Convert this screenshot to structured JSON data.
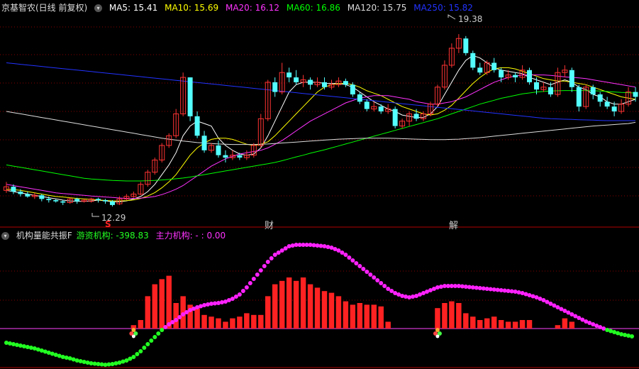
{
  "main_panel": {
    "title": "京基智农(日线 前复权)",
    "ma": [
      {
        "label": "MA5: 15.41",
        "color": "#ffffff"
      },
      {
        "label": "MA10: 15.69",
        "color": "#ffff00"
      },
      {
        "label": "MA20: 16.12",
        "color": "#ff33ff"
      },
      {
        "label": "MA60: 16.86",
        "color": "#00ff00"
      },
      {
        "label": "MA120: 15.75",
        "color": "#dddddd"
      },
      {
        "label": "MA250: 15.82",
        "color": "#2233ff"
      }
    ],
    "high_label": "19.38",
    "low_label": "12.29",
    "markers": [
      {
        "text": "S",
        "color": "#ff2222"
      },
      {
        "text": "财",
        "color": "#cccccc"
      },
      {
        "text": "解",
        "color": "#cccccc"
      }
    ],
    "menu_icon": "chevron-down-icon"
  },
  "sub_panel": {
    "title": "机构量能共振F",
    "youzi_label": "游资机构: -398.83",
    "zhuli_label": "主力机构: - : 0.00",
    "menu_icon": "chevron-down-icon"
  },
  "colors": {
    "up": "#ff3333",
    "down": "#54ffff",
    "bar": "#ff2222",
    "line_pos": "#ff22ff",
    "line_neg": "#22ff22",
    "axis": "#ff44ff"
  },
  "chart_data": {
    "type": "candlestick",
    "y_range_price": [
      11.5,
      20.2
    ],
    "candles": [
      [
        12.95,
        13.1,
        13.3,
        12.85
      ],
      [
        13.1,
        12.9,
        13.2,
        12.8
      ],
      [
        12.9,
        12.8,
        13.0,
        12.7
      ],
      [
        12.8,
        12.7,
        12.9,
        12.65
      ],
      [
        12.7,
        12.75,
        12.85,
        12.6
      ],
      [
        12.75,
        12.6,
        12.8,
        12.5
      ],
      [
        12.6,
        12.55,
        12.7,
        12.45
      ],
      [
        12.55,
        12.5,
        12.6,
        12.45
      ],
      [
        12.5,
        12.45,
        12.55,
        12.35
      ],
      [
        12.45,
        12.6,
        12.65,
        12.4
      ],
      [
        12.6,
        12.5,
        12.65,
        12.4
      ],
      [
        12.5,
        12.55,
        12.6,
        12.45
      ],
      [
        12.5,
        12.6,
        12.65,
        12.45
      ],
      [
        12.6,
        12.55,
        12.65,
        12.45
      ],
      [
        12.55,
        12.5,
        12.6,
        12.4
      ],
      [
        12.5,
        12.35,
        12.55,
        12.29
      ],
      [
        12.4,
        12.6,
        12.7,
        12.35
      ],
      [
        12.6,
        12.7,
        12.8,
        12.55
      ],
      [
        12.7,
        12.8,
        12.9,
        12.65
      ],
      [
        12.8,
        13.2,
        13.3,
        12.75
      ],
      [
        13.2,
        13.7,
        13.8,
        13.1
      ],
      [
        13.7,
        14.2,
        14.3,
        13.6
      ],
      [
        14.2,
        14.8,
        14.9,
        14.1
      ],
      [
        14.8,
        15.2,
        15.3,
        14.7
      ],
      [
        15.2,
        16.1,
        16.3,
        15.1
      ],
      [
        16.1,
        17.6,
        17.8,
        16.0
      ],
      [
        17.6,
        16.0,
        17.6,
        15.8
      ],
      [
        16.0,
        15.2,
        16.2,
        15.1
      ],
      [
        15.2,
        14.6,
        15.4,
        14.5
      ],
      [
        14.6,
        14.8,
        14.9,
        14.5
      ],
      [
        14.8,
        14.4,
        15.0,
        14.3
      ],
      [
        14.4,
        14.3,
        14.6,
        14.1
      ],
      [
        14.3,
        14.4,
        14.6,
        14.2
      ],
      [
        14.4,
        14.3,
        14.5,
        14.2
      ],
      [
        14.3,
        14.4,
        14.6,
        14.2
      ],
      [
        14.4,
        14.8,
        14.9,
        14.3
      ],
      [
        14.8,
        15.9,
        16.1,
        14.7
      ],
      [
        15.9,
        17.4,
        17.5,
        15.8
      ],
      [
        17.4,
        17.0,
        17.6,
        16.8
      ],
      [
        17.0,
        17.8,
        18.2,
        16.9
      ],
      [
        17.8,
        17.6,
        18.0,
        17.4
      ],
      [
        17.6,
        17.4,
        17.9,
        17.3
      ],
      [
        17.4,
        17.5,
        17.7,
        17.2
      ],
      [
        17.5,
        17.3,
        17.6,
        17.1
      ],
      [
        17.3,
        17.4,
        17.6,
        17.2
      ],
      [
        17.4,
        17.2,
        17.6,
        17.1
      ],
      [
        17.2,
        17.3,
        17.5,
        17.1
      ],
      [
        17.3,
        17.45,
        17.6,
        17.2
      ],
      [
        17.45,
        17.3,
        17.55,
        17.2
      ],
      [
        17.3,
        16.9,
        17.4,
        16.8
      ],
      [
        16.9,
        16.6,
        17.0,
        16.5
      ],
      [
        16.6,
        16.3,
        16.7,
        16.2
      ],
      [
        16.3,
        16.4,
        16.6,
        16.2
      ],
      [
        16.4,
        16.2,
        16.5,
        16.1
      ],
      [
        16.2,
        16.3,
        16.5,
        16.1
      ],
      [
        16.3,
        15.6,
        16.4,
        15.5
      ],
      [
        15.6,
        15.8,
        15.9,
        15.5
      ],
      [
        15.8,
        16.1,
        16.2,
        15.6
      ],
      [
        16.1,
        15.9,
        16.3,
        15.8
      ],
      [
        15.9,
        16.1,
        16.2,
        15.8
      ],
      [
        16.1,
        16.5,
        16.6,
        16.0
      ],
      [
        16.5,
        17.2,
        17.3,
        16.4
      ],
      [
        17.2,
        18.1,
        18.3,
        17.1
      ],
      [
        18.1,
        18.8,
        19.0,
        18.0
      ],
      [
        18.8,
        19.2,
        19.38,
        18.6
      ],
      [
        19.2,
        18.6,
        19.3,
        18.5
      ],
      [
        18.6,
        18.0,
        18.7,
        17.9
      ],
      [
        18.0,
        17.8,
        18.2,
        17.7
      ],
      [
        17.8,
        18.2,
        18.3,
        17.7
      ],
      [
        18.2,
        17.9,
        18.4,
        17.8
      ],
      [
        17.9,
        17.6,
        18.0,
        17.4
      ],
      [
        17.6,
        17.7,
        17.9,
        17.5
      ],
      [
        17.7,
        17.6,
        17.8,
        17.4
      ],
      [
        17.6,
        17.9,
        18.1,
        17.5
      ],
      [
        17.9,
        17.4,
        18.0,
        17.3
      ],
      [
        17.4,
        17.1,
        17.6,
        16.9
      ],
      [
        17.1,
        17.2,
        17.4,
        17.0
      ],
      [
        17.2,
        16.9,
        17.4,
        16.8
      ],
      [
        16.9,
        17.8,
        18.0,
        16.8
      ],
      [
        17.8,
        17.9,
        18.1,
        17.6
      ],
      [
        17.9,
        17.2,
        18.0,
        17.0
      ],
      [
        17.2,
        16.4,
        17.3,
        16.2
      ],
      [
        16.4,
        17.2,
        17.3,
        16.3
      ],
      [
        17.2,
        16.9,
        17.3,
        16.7
      ],
      [
        16.9,
        16.6,
        17.0,
        16.4
      ],
      [
        16.6,
        16.4,
        16.8,
        16.3
      ],
      [
        16.4,
        16.2,
        16.6,
        16.0
      ],
      [
        16.2,
        16.5,
        16.7,
        16.1
      ],
      [
        16.5,
        17.0,
        17.2,
        16.4
      ],
      [
        17.0,
        16.8,
        17.2,
        16.6
      ]
    ],
    "ma_lines": {
      "ma5": [
        12.95,
        12.9,
        12.85,
        12.8,
        12.75,
        12.7,
        12.65,
        12.6,
        12.55,
        12.52,
        12.5,
        12.5,
        12.52,
        12.55,
        12.52,
        12.48,
        12.48,
        12.52,
        12.6,
        12.7,
        12.9,
        13.2,
        13.6,
        14.0,
        14.5,
        15.2,
        15.6,
        15.8,
        15.7,
        15.6,
        15.1,
        14.8,
        14.6,
        14.45,
        14.4,
        14.45,
        14.7,
        15.2,
        15.8,
        16.4,
        17.0,
        17.3,
        17.4,
        17.4,
        17.4,
        17.35,
        17.35,
        17.35,
        17.3,
        17.2,
        17.0,
        16.8,
        16.6,
        16.45,
        16.3,
        16.2,
        16.05,
        16.0,
        15.95,
        15.95,
        16.1,
        16.4,
        16.9,
        17.4,
        17.9,
        18.3,
        18.5,
        18.4,
        18.2,
        18.0,
        17.9,
        17.85,
        17.8,
        17.75,
        17.6,
        17.5,
        17.4,
        17.3,
        17.4,
        17.5,
        17.4,
        17.2,
        17.1,
        16.9,
        16.8,
        16.6,
        16.5,
        16.5,
        16.6,
        16.7
      ],
      "ma10": [
        13.0,
        12.98,
        12.95,
        12.9,
        12.85,
        12.8,
        12.75,
        12.7,
        12.68,
        12.65,
        12.62,
        12.6,
        12.58,
        12.56,
        12.54,
        12.52,
        12.52,
        12.53,
        12.56,
        12.62,
        12.72,
        12.86,
        13.06,
        13.3,
        13.6,
        14.0,
        14.4,
        14.7,
        14.9,
        15.05,
        15.1,
        15.1,
        15.05,
        14.95,
        14.85,
        14.8,
        14.85,
        14.95,
        15.2,
        15.5,
        15.8,
        16.1,
        16.4,
        16.7,
        17.0,
        17.2,
        17.3,
        17.35,
        17.35,
        17.3,
        17.2,
        17.05,
        16.95,
        16.85,
        16.7,
        16.55,
        16.4,
        16.3,
        16.2,
        16.1,
        16.05,
        16.1,
        16.25,
        16.45,
        16.75,
        17.05,
        17.35,
        17.6,
        17.8,
        17.95,
        18.0,
        18.0,
        17.95,
        17.85,
        17.75,
        17.65,
        17.55,
        17.5,
        17.45,
        17.45,
        17.4,
        17.35,
        17.3,
        17.2,
        17.1,
        17.0,
        16.9,
        16.8,
        16.75,
        16.7
      ],
      "ma20": [
        13.2,
        13.15,
        13.1,
        13.05,
        13.0,
        12.95,
        12.9,
        12.85,
        12.82,
        12.8,
        12.77,
        12.75,
        12.72,
        12.7,
        12.68,
        12.66,
        12.64,
        12.62,
        12.62,
        12.63,
        12.66,
        12.7,
        12.78,
        12.88,
        13.0,
        13.15,
        13.35,
        13.55,
        13.75,
        13.95,
        14.1,
        14.25,
        14.35,
        14.45,
        14.5,
        14.55,
        14.6,
        14.7,
        14.85,
        15.0,
        15.2,
        15.4,
        15.6,
        15.8,
        15.95,
        16.1,
        16.25,
        16.4,
        16.55,
        16.65,
        16.75,
        16.8,
        16.85,
        16.85,
        16.85,
        16.8,
        16.75,
        16.7,
        16.6,
        16.55,
        16.5,
        16.5,
        16.55,
        16.6,
        16.7,
        16.8,
        16.95,
        17.1,
        17.25,
        17.4,
        17.5,
        17.6,
        17.65,
        17.7,
        17.7,
        17.7,
        17.7,
        17.68,
        17.65,
        17.62,
        17.6,
        17.58,
        17.55,
        17.5,
        17.45,
        17.4,
        17.35,
        17.3,
        17.25,
        17.2
      ],
      "ma60": [
        14.0,
        13.95,
        13.9,
        13.85,
        13.8,
        13.75,
        13.7,
        13.65,
        13.6,
        13.55,
        13.5,
        13.45,
        13.42,
        13.4,
        13.38,
        13.36,
        13.35,
        13.34,
        13.34,
        13.34,
        13.35,
        13.36,
        13.38,
        13.4,
        13.43,
        13.46,
        13.5,
        13.55,
        13.6,
        13.65,
        13.7,
        13.75,
        13.8,
        13.85,
        13.9,
        13.95,
        14.0,
        14.05,
        14.1,
        14.17,
        14.25,
        14.33,
        14.4,
        14.48,
        14.55,
        14.62,
        14.7,
        14.78,
        14.86,
        14.94,
        15.02,
        15.1,
        15.18,
        15.26,
        15.34,
        15.42,
        15.5,
        15.58,
        15.66,
        15.74,
        15.82,
        15.9,
        16.0,
        16.1,
        16.2,
        16.3,
        16.4,
        16.5,
        16.58,
        16.66,
        16.74,
        16.8,
        16.86,
        16.92,
        16.96,
        17.0,
        17.02,
        17.04,
        17.05,
        17.06,
        17.06,
        17.06,
        17.06,
        17.05,
        17.04,
        17.02,
        17.0,
        16.98,
        16.97,
        16.96
      ],
      "ma120": [
        16.2,
        16.15,
        16.1,
        16.05,
        16.0,
        15.95,
        15.9,
        15.85,
        15.8,
        15.75,
        15.7,
        15.65,
        15.6,
        15.55,
        15.5,
        15.45,
        15.4,
        15.35,
        15.3,
        15.25,
        15.2,
        15.15,
        15.1,
        15.06,
        15.02,
        14.98,
        14.95,
        14.92,
        14.9,
        14.88,
        14.86,
        14.85,
        14.84,
        14.84,
        14.84,
        14.84,
        14.85,
        14.86,
        14.88,
        14.9,
        14.92,
        14.94,
        14.96,
        14.98,
        15.0,
        15.02,
        15.04,
        15.06,
        15.07,
        15.08,
        15.09,
        15.1,
        15.1,
        15.1,
        15.1,
        15.09,
        15.08,
        15.07,
        15.06,
        15.05,
        15.04,
        15.04,
        15.04,
        15.05,
        15.06,
        15.08,
        15.1,
        15.12,
        15.15,
        15.18,
        15.21,
        15.24,
        15.27,
        15.3,
        15.33,
        15.36,
        15.39,
        15.42,
        15.45,
        15.48,
        15.51,
        15.54,
        15.57,
        15.6,
        15.62,
        15.64,
        15.66,
        15.68,
        15.7,
        15.75
      ],
      "ma250": [
        18.2,
        18.17,
        18.14,
        18.11,
        18.08,
        18.05,
        18.02,
        17.99,
        17.96,
        17.93,
        17.9,
        17.87,
        17.84,
        17.81,
        17.78,
        17.75,
        17.72,
        17.69,
        17.66,
        17.63,
        17.6,
        17.57,
        17.54,
        17.51,
        17.48,
        17.45,
        17.42,
        17.39,
        17.36,
        17.33,
        17.3,
        17.27,
        17.24,
        17.21,
        17.18,
        17.15,
        17.12,
        17.09,
        17.06,
        17.03,
        17.0,
        16.97,
        16.94,
        16.91,
        16.88,
        16.85,
        16.82,
        16.79,
        16.76,
        16.73,
        16.7,
        16.67,
        16.64,
        16.61,
        16.58,
        16.55,
        16.52,
        16.49,
        16.46,
        16.43,
        16.4,
        16.37,
        16.34,
        16.31,
        16.28,
        16.25,
        16.22,
        16.19,
        16.16,
        16.13,
        16.1,
        16.07,
        16.04,
        16.01,
        15.98,
        15.95,
        15.92,
        15.9,
        15.89,
        15.88,
        15.87,
        15.86,
        15.85,
        15.84,
        15.83,
        15.82,
        15.82,
        15.82,
        15.82,
        15.82
      ]
    },
    "osc_bars": [
      0,
      0,
      0,
      0,
      0,
      0,
      0,
      0,
      0,
      0,
      0,
      0,
      0,
      0,
      0,
      0,
      0,
      0,
      4,
      10,
      38,
      52,
      58,
      62,
      30,
      38,
      28,
      24,
      16,
      14,
      12,
      8,
      12,
      14,
      18,
      16,
      16,
      38,
      52,
      56,
      60,
      56,
      60,
      52,
      48,
      44,
      42,
      38,
      32,
      28,
      30,
      28,
      28,
      26,
      8,
      0,
      0,
      0,
      0,
      0,
      0,
      0,
      0,
      0,
      0,
      0,
      0,
      0,
      0,
      0,
      0,
      0,
      0,
      0,
      0,
      0,
      0,
      0,
      0,
      0,
      0,
      0,
      0,
      0,
      0,
      0,
      0,
      0,
      0,
      0
    ],
    "osc_bars_b": [
      0,
      0,
      0,
      0,
      0,
      0,
      0,
      0,
      0,
      0,
      0,
      0,
      0,
      0,
      0,
      0,
      0,
      0,
      0,
      0,
      0,
      0,
      0,
      0,
      0,
      0,
      0,
      0,
      0,
      0,
      0,
      0,
      0,
      0,
      0,
      0,
      0,
      0,
      0,
      0,
      0,
      0,
      0,
      0,
      0,
      0,
      0,
      0,
      0,
      0,
      0,
      0,
      0,
      0,
      0,
      0,
      0,
      0,
      0,
      0,
      0,
      24,
      30,
      32,
      30,
      18,
      14,
      10,
      12,
      14,
      10,
      8,
      8,
      10,
      10,
      0,
      0,
      0,
      4,
      12,
      8,
      0,
      0,
      0,
      0,
      0,
      0,
      0,
      0,
      0
    ],
    "osc_line": [
      -20,
      -22,
      -24,
      -26,
      -28,
      -31,
      -34,
      -37,
      -40,
      -42,
      -45,
      -47,
      -49,
      -50,
      -51,
      -50,
      -48,
      -45,
      -40,
      -32,
      -22,
      -12,
      -2,
      6,
      12,
      20,
      26,
      30,
      33,
      35,
      36,
      38,
      42,
      48,
      58,
      70,
      82,
      94,
      104,
      110,
      116,
      118,
      118,
      118,
      117,
      116,
      114,
      110,
      104,
      96,
      88,
      80,
      72,
      64,
      56,
      50,
      46,
      44,
      46,
      50,
      54,
      58,
      60,
      60,
      60,
      59,
      58,
      57,
      56,
      55,
      54,
      53,
      52,
      50,
      47,
      44,
      40,
      35,
      30,
      25,
      20,
      15,
      10,
      6,
      2,
      -2,
      -5,
      -8,
      -10,
      -12
    ]
  }
}
